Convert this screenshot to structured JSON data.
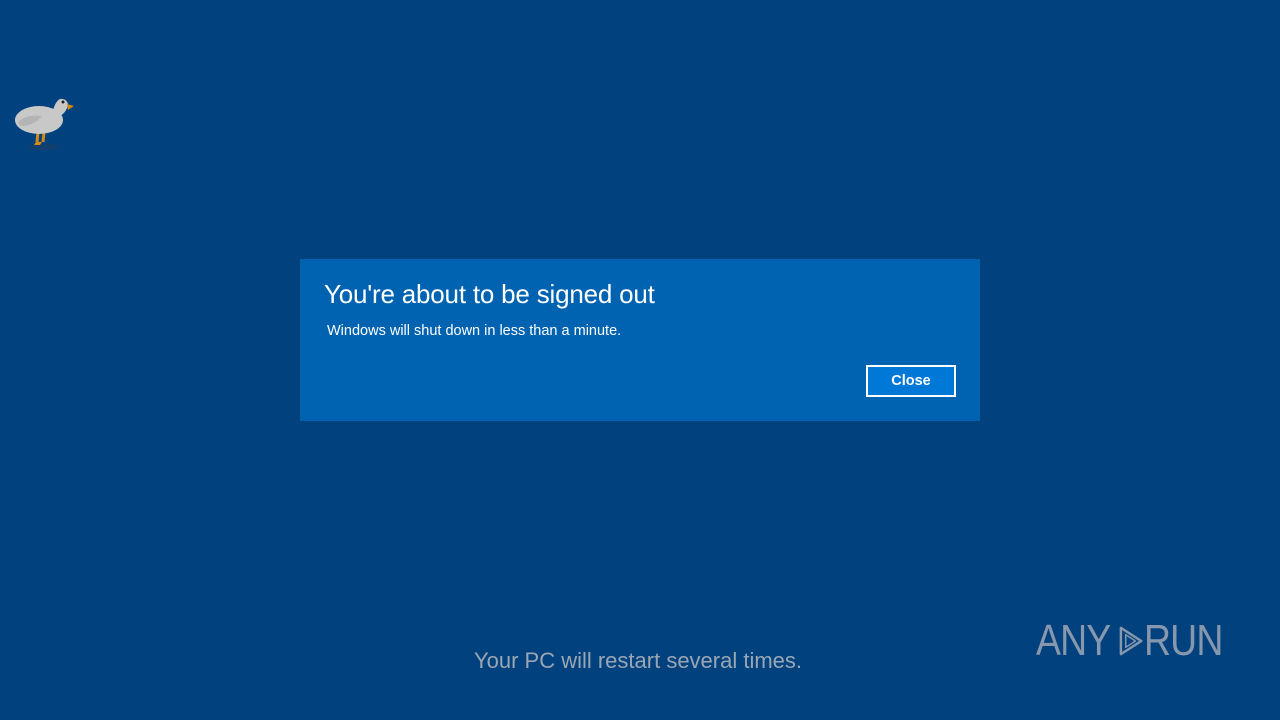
{
  "dialog": {
    "title": "You're about to be signed out",
    "message": "Windows will shut down in less than a minute.",
    "close_label": "Close"
  },
  "footer": {
    "restart_message": "Your PC will restart several times."
  },
  "watermark": {
    "left_text": "ANY",
    "right_text": "RUN"
  },
  "colors": {
    "background": "#01427e",
    "dialog": "#0063b1",
    "button": "#0078d7"
  },
  "icons": {
    "desktop_pet": "goose-icon",
    "watermark": "play-icon"
  }
}
